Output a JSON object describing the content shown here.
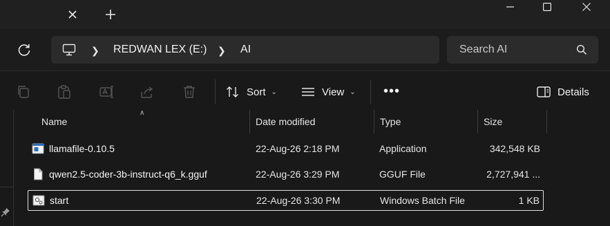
{
  "addressbar": {
    "crumbs": [
      "REDWAN LEX (E:)",
      "AI"
    ]
  },
  "search": {
    "placeholder": "Search AI"
  },
  "toolbar": {
    "sort_label": "Sort",
    "view_label": "View",
    "more_label": "•••",
    "details_label": "Details"
  },
  "columns": {
    "name": "Name",
    "date": "Date modified",
    "type": "Type",
    "size": "Size"
  },
  "files": [
    {
      "name": "llamafile-0.10.5",
      "date": "22-Aug-26 2:18 PM",
      "type": "Application",
      "size": "342,548 KB",
      "icon": "application-icon"
    },
    {
      "name": "qwen2.5-coder-3b-instruct-q6_k.gguf",
      "date": "22-Aug-26 3:29 PM",
      "type": "GGUF File",
      "size": "2,727,941 ...",
      "icon": "document-icon"
    },
    {
      "name": "start",
      "date": "22-Aug-26 3:30 PM",
      "type": "Windows Batch File",
      "size": "1 KB",
      "icon": "batch-file-icon"
    }
  ],
  "colors": {
    "background": "#191919",
    "chrome": "#202020",
    "field": "#2b2b2b",
    "text": "#e6e6e6"
  }
}
